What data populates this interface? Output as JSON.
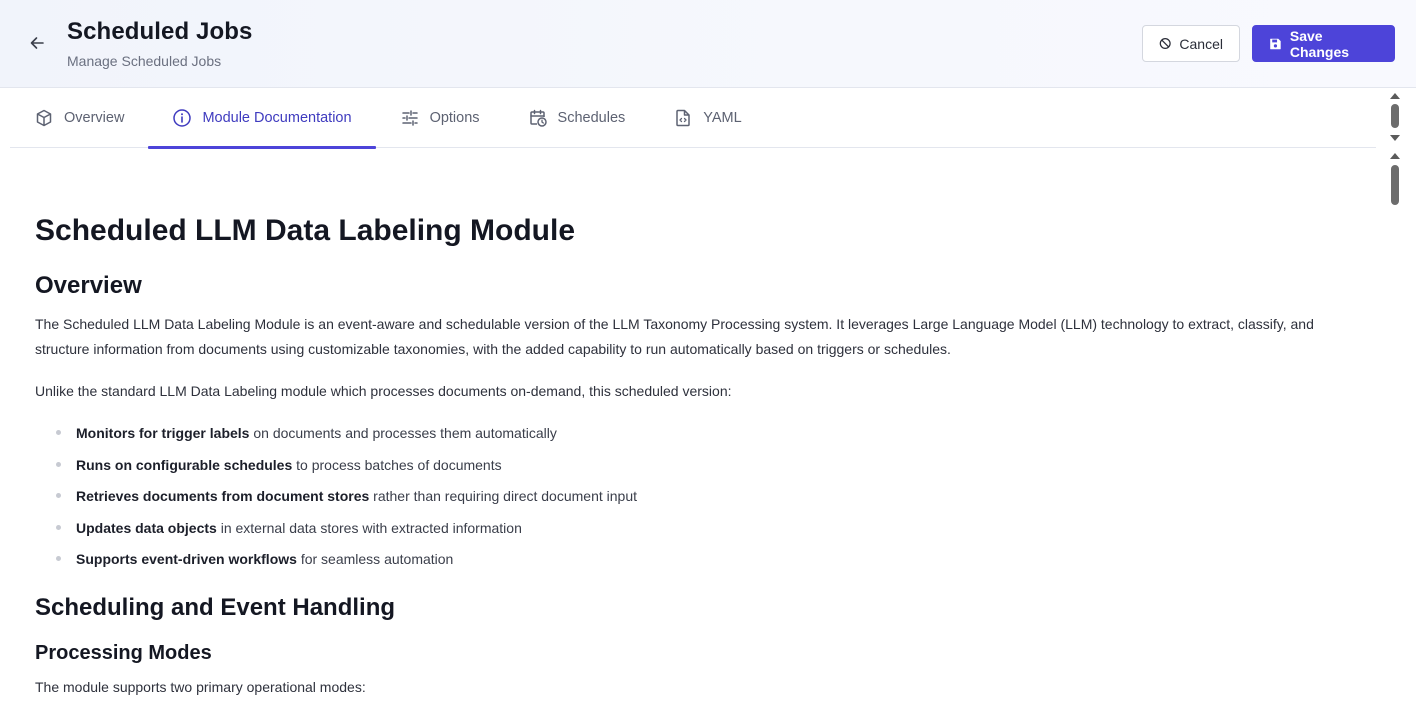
{
  "header": {
    "title": "Scheduled Jobs",
    "subtitle": "Manage Scheduled Jobs",
    "cancel_label": "Cancel",
    "save_label": "Save Changes"
  },
  "tabs": [
    {
      "label": "Overview",
      "icon": "cube-icon",
      "active": false
    },
    {
      "label": "Module Documentation",
      "icon": "info-circle-icon",
      "active": true
    },
    {
      "label": "Options",
      "icon": "sliders-icon",
      "active": false
    },
    {
      "label": "Schedules",
      "icon": "calendar-clock-icon",
      "active": false
    },
    {
      "label": "YAML",
      "icon": "code-file-icon",
      "active": false
    }
  ],
  "doc": {
    "title": "Scheduled LLM Data Labeling Module",
    "overview_heading": "Overview",
    "overview_p1": "The Scheduled LLM Data Labeling Module is an event-aware and schedulable version of the LLM Taxonomy Processing system. It leverages Large Language Model (LLM) technology to extract, classify, and structure information from documents using customizable taxonomies, with the added capability to run automatically based on triggers or schedules.",
    "overview_p2": "Unlike the standard LLM Data Labeling module which processes documents on-demand, this scheduled version:",
    "bullets": [
      {
        "bold": "Monitors for trigger labels",
        "rest": " on documents and processes them automatically"
      },
      {
        "bold": "Runs on configurable schedules",
        "rest": " to process batches of documents"
      },
      {
        "bold": "Retrieves documents from document stores",
        "rest": " rather than requiring direct document input"
      },
      {
        "bold": "Updates data objects",
        "rest": " in external data stores with extracted information"
      },
      {
        "bold": "Supports event-driven workflows",
        "rest": " for seamless automation"
      }
    ],
    "scheduling_heading": "Scheduling and Event Handling",
    "modes_heading": "Processing Modes",
    "modes_p": "The module supports two primary operational modes:"
  },
  "colors": {
    "accent": "#4d44d9",
    "header_bg": "#f3f5fc"
  }
}
